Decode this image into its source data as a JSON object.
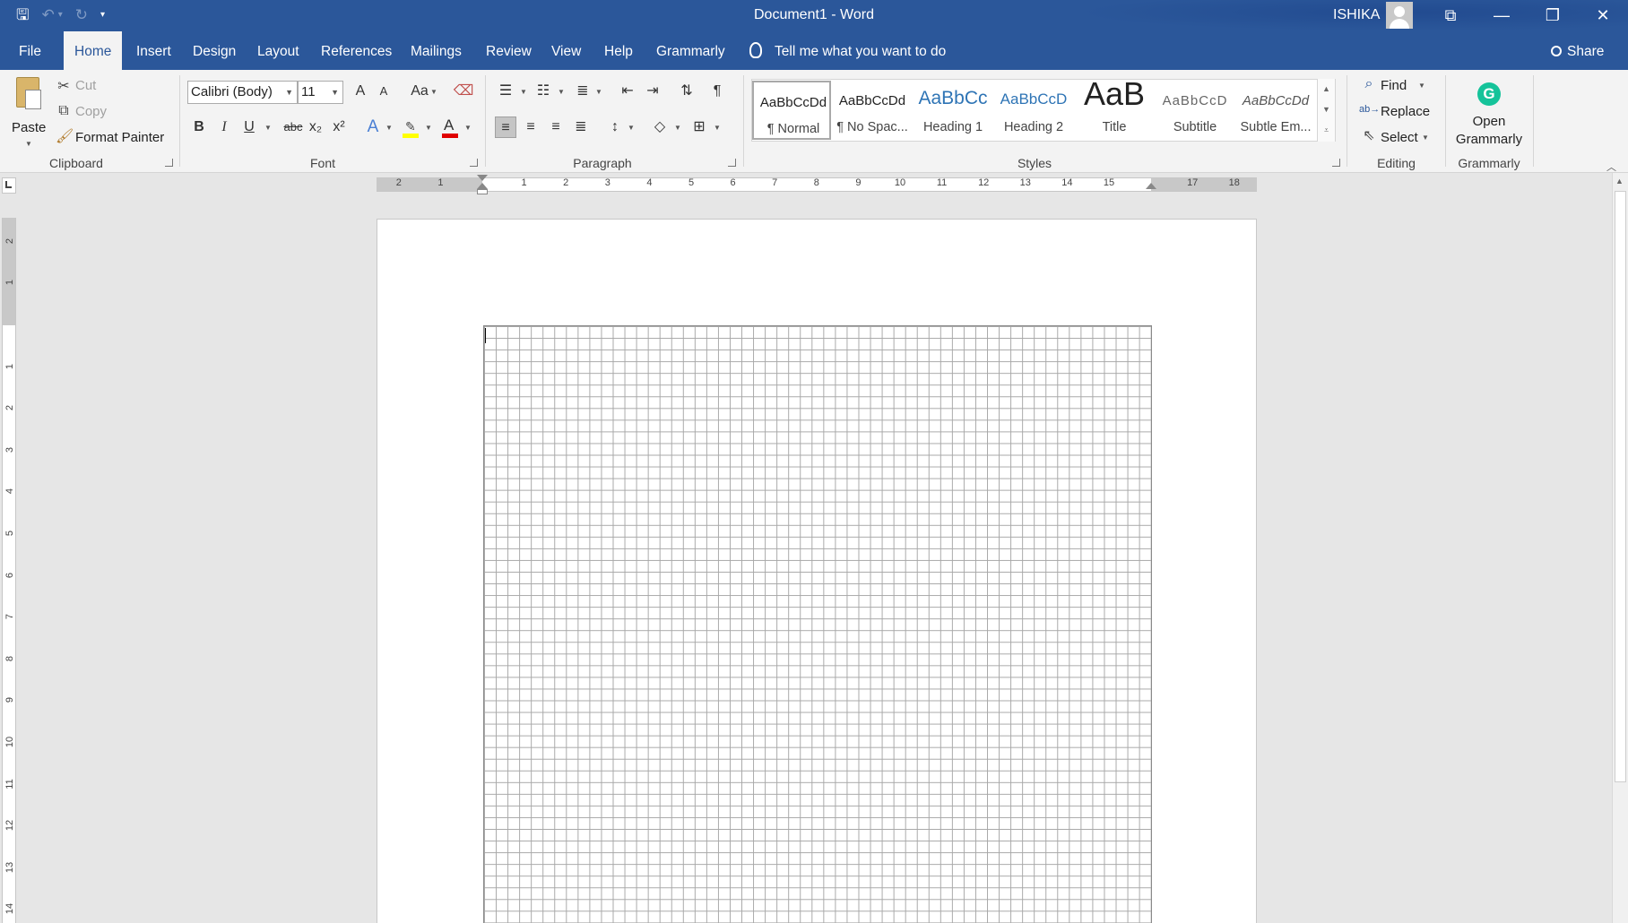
{
  "window": {
    "doc_title": "Document1  -  Word",
    "user_name": "ISHIKA",
    "controls": {
      "ribbon_options": "⧉",
      "minimize": "—",
      "restore": "❐",
      "close": "✕"
    }
  },
  "qat": {
    "save": "🖫",
    "undo": "↶",
    "undo_arrow": "▾",
    "redo": "↻",
    "customize": "▾"
  },
  "tabs": [
    {
      "label": "File"
    },
    {
      "label": "Home"
    },
    {
      "label": "Insert"
    },
    {
      "label": "Design"
    },
    {
      "label": "Layout"
    },
    {
      "label": "References"
    },
    {
      "label": "Mailings"
    },
    {
      "label": "Review"
    },
    {
      "label": "View"
    },
    {
      "label": "Help"
    },
    {
      "label": "Grammarly"
    }
  ],
  "tell_me": "Tell me what you want to do",
  "share": "Share",
  "clipboard": {
    "group": "Clipboard",
    "paste": "Paste",
    "cut": "Cut",
    "copy": "Copy",
    "format_painter": "Format Painter"
  },
  "font": {
    "group": "Font",
    "family": "Calibri (Body)",
    "size": "11",
    "grow": "A",
    "shrink": "A",
    "change_case": "Aa",
    "bold": "B",
    "italic": "I",
    "underline": "U",
    "strike": "abc",
    "subscript": "x₂",
    "superscript": "x²",
    "text_effects": "A",
    "font_color": "A",
    "highlight_color": "#ffff00",
    "font_color_bar": "#e00000"
  },
  "paragraph": {
    "group": "Paragraph",
    "pilcrow": "¶"
  },
  "styles": {
    "group": "Styles",
    "items": [
      {
        "sample": "AaBbCcDd",
        "name": "¶ Normal"
      },
      {
        "sample": "AaBbCcDd",
        "name": "¶ No Spac..."
      },
      {
        "sample": "AaBbCc",
        "name": "Heading 1"
      },
      {
        "sample": "AaBbCcD",
        "name": "Heading 2"
      },
      {
        "sample": "AaB",
        "name": "Title"
      },
      {
        "sample": "AaBbCcD",
        "name": "Subtitle"
      },
      {
        "sample": "AaBbCcDd",
        "name": "Subtle Em..."
      }
    ]
  },
  "editing": {
    "group": "Editing",
    "find": "Find",
    "replace": "Replace",
    "select": "Select"
  },
  "grammarly": {
    "group": "Grammarly",
    "open_line1": "Open",
    "open_line2": "Grammarly",
    "logo": "G"
  },
  "ruler": {
    "h_numbers": [
      "2",
      "1",
      "1",
      "2",
      "3",
      "4",
      "5",
      "6",
      "7",
      "8",
      "9",
      "10",
      "11",
      "12",
      "13",
      "14",
      "15",
      "17",
      "18"
    ],
    "v_numbers": [
      "2",
      "1",
      "1",
      "2",
      "3",
      "4",
      "5",
      "6",
      "7",
      "8",
      "9",
      "10",
      "11",
      "12",
      "13",
      "14"
    ]
  }
}
